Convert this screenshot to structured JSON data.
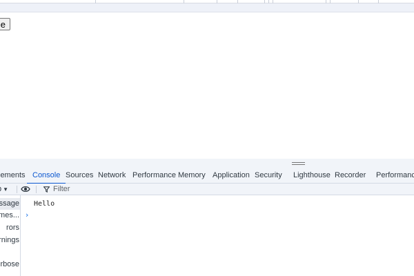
{
  "page": {
    "button_label": "le"
  },
  "devtools": {
    "tabs": [
      {
        "label": "lements"
      },
      {
        "label": "Console"
      },
      {
        "label": "Sources"
      },
      {
        "label": "Network"
      },
      {
        "label": "Performance"
      },
      {
        "label": "Memory"
      },
      {
        "label": "Application"
      },
      {
        "label": "Security"
      },
      {
        "label": "Lighthouse"
      },
      {
        "label": "Recorder"
      },
      {
        "label": "Performance in"
      }
    ],
    "active_tab": "Console",
    "toolbar": {
      "context_label": "p",
      "filter_placeholder": "Filter"
    },
    "sidebar": [
      {
        "label": "ssage",
        "selected": true
      },
      {
        "label": "r mes..."
      },
      {
        "label": "rors"
      },
      {
        "label": "arnings"
      },
      {
        "label": ""
      },
      {
        "label": "rbose"
      }
    ],
    "console": {
      "messages": [
        "Hello"
      ],
      "prompt_glyph": "›"
    },
    "colors": {
      "accent": "#0b57d0",
      "prompt": "#1a73e8",
      "panel_bg": "#f1f4f9"
    },
    "icons": [
      "eye-icon",
      "filter-icon",
      "chevron-right-icon",
      "drag-handle-icon",
      "caret-down-icon"
    ]
  }
}
